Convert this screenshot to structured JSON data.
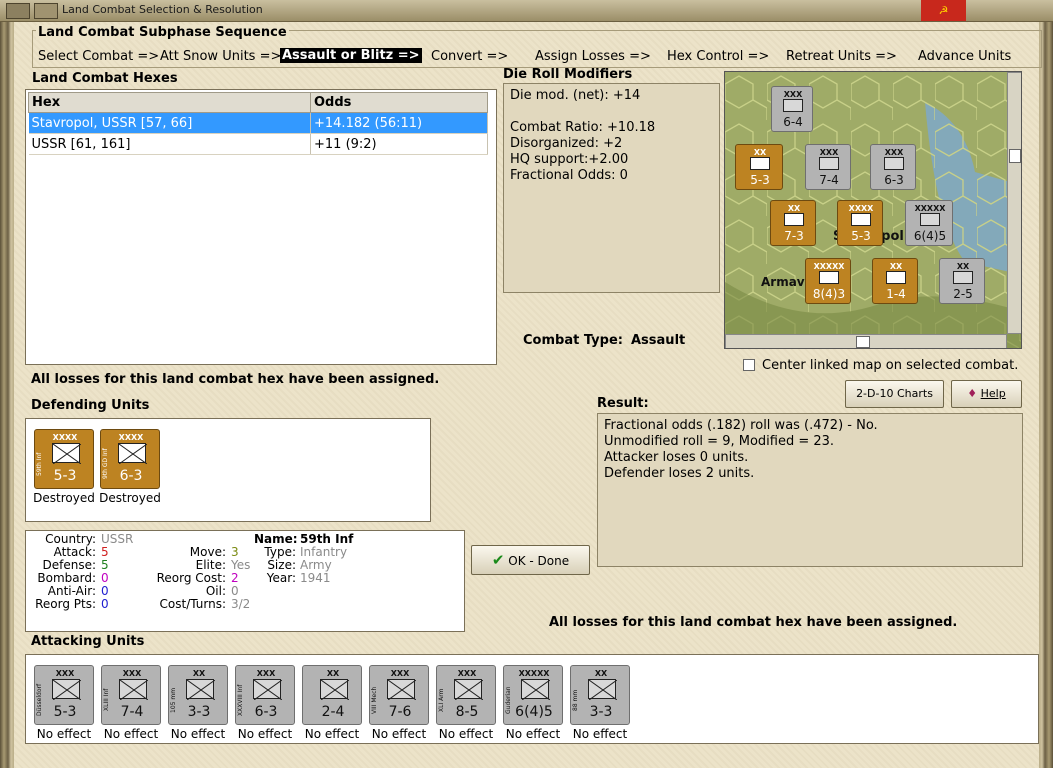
{
  "window": {
    "title": "Land Combat Selection & Resolution"
  },
  "subphase": {
    "title": "Land Combat Subphase Sequence",
    "steps": [
      "Select Combat =>",
      "Att Snow Units =>",
      "Assault or Blitz =>",
      "Convert =>",
      "Assign Losses =>",
      "Hex Control =>",
      "Retreat Units =>",
      "Advance Units"
    ],
    "active_index": 2
  },
  "combat_hexes": {
    "title": "Land Combat Hexes",
    "columns": [
      "Hex",
      "Odds"
    ],
    "rows": [
      {
        "hex": "Stavropol, USSR [57, 66]",
        "odds": "+14.182 (56:11)"
      },
      {
        "hex": "USSR [61, 161]",
        "odds": "+11 (9:2)"
      }
    ]
  },
  "die_roll": {
    "title": "Die Roll Modifiers",
    "lines": [
      "Die mod. (net): +14",
      "",
      "Combat Ratio: +10.18",
      "Disorganized: +2",
      "HQ support:+2.00",
      "Fractional Odds: 0"
    ]
  },
  "combat_type": {
    "label": "Combat Type:",
    "value": "Assault"
  },
  "center_map": {
    "label": "Center linked map on selected combat."
  },
  "buttons": {
    "charts": "2-D-10 Charts",
    "help": "Help",
    "ok": "OK - Done"
  },
  "losses_msg": "All losses for this land combat hex have been assigned.",
  "defending": {
    "title": "Defending Units",
    "units": [
      {
        "size": "XXXX",
        "name": "59th Inf",
        "str": "5-3",
        "status": "Destroyed"
      },
      {
        "size": "XXXX",
        "name": "9th GD Inf",
        "str": "6-3",
        "status": "Destroyed"
      }
    ]
  },
  "result": {
    "title": "Result:",
    "lines": [
      "Fractional odds (.182) roll was (.472)  - No.",
      "Unmodified roll = 9, Modified = 23.",
      "Attacker loses 0 units.",
      "Defender loses 2 units."
    ]
  },
  "unit_info": {
    "country_label": "Country:",
    "country": "USSR",
    "attack_label": "Attack:",
    "attack": "5",
    "defense_label": "Defense:",
    "defense": "5",
    "bombard_label": "Bombard:",
    "bombard": "0",
    "antiair_label": "Anti-Air:",
    "antiair": "0",
    "reorg_pts_label": "Reorg Pts:",
    "reorg_pts": "0",
    "name_label": "Name:",
    "name": "59th Inf",
    "move_label": "Move:",
    "move": "3",
    "elite_label": "Elite:",
    "elite": "Yes",
    "reorg_cost_label": "Reorg Cost:",
    "reorg_cost": "2",
    "oil_label": "Oil:",
    "oil": "0",
    "cost_turns_label": "Cost/Turns:",
    "cost_turns": "3/2",
    "type_label": "Type:",
    "type": "Infantry",
    "unit_size_label": "Size:",
    "unit_size": "Army",
    "year_label": "Year:",
    "year": "1941"
  },
  "attacking": {
    "title": "Attacking Units",
    "units": [
      {
        "size": "XXX",
        "name": "Düsseldorf",
        "str": "5-3",
        "status": "No effect",
        "style": "gray"
      },
      {
        "size": "XXX",
        "name": "XLIII Inf",
        "str": "7-4",
        "status": "No effect",
        "style": "gray"
      },
      {
        "size": "XX",
        "name": "105 mm",
        "str": "3-3",
        "status": "No effect",
        "style": "gray"
      },
      {
        "size": "XXX",
        "name": "XXXVIII Inf",
        "str": "6-3",
        "status": "No effect",
        "style": "gray"
      },
      {
        "size": "XX",
        "name": "",
        "str": "2-4",
        "status": "No effect",
        "style": "gray"
      },
      {
        "size": "XXX",
        "name": "VIII Mech",
        "str": "7-6",
        "status": "No effect",
        "style": "gray"
      },
      {
        "size": "XXX",
        "name": "XLI Arm",
        "str": "8-5",
        "status": "No effect",
        "style": "gray"
      },
      {
        "size": "XXXXX",
        "name": "Guderian",
        "str": "6(4)5",
        "status": "No effect",
        "style": "gray"
      },
      {
        "size": "XX",
        "name": "88 mm",
        "str": "3-3",
        "status": "No effect",
        "style": "gray"
      }
    ]
  },
  "map": {
    "labels": [
      "Armav",
      "Stavropol"
    ],
    "counters": [
      {
        "str": "6-4",
        "size": "XXX"
      },
      {
        "str": "5-3",
        "size": "XX"
      },
      {
        "str": "7-4",
        "size": "XXX"
      },
      {
        "str": "6-3",
        "size": "XXX"
      },
      {
        "str": "7-3",
        "size": "XX"
      },
      {
        "str": "5-3",
        "size": "XXXX"
      },
      {
        "str": "6(4)5",
        "size": "XXXXX"
      },
      {
        "str": "8(4)3",
        "size": "XXXXX"
      },
      {
        "str": "1-4",
        "size": "XX"
      },
      {
        "str": "2-5",
        "size": "XX"
      }
    ]
  }
}
